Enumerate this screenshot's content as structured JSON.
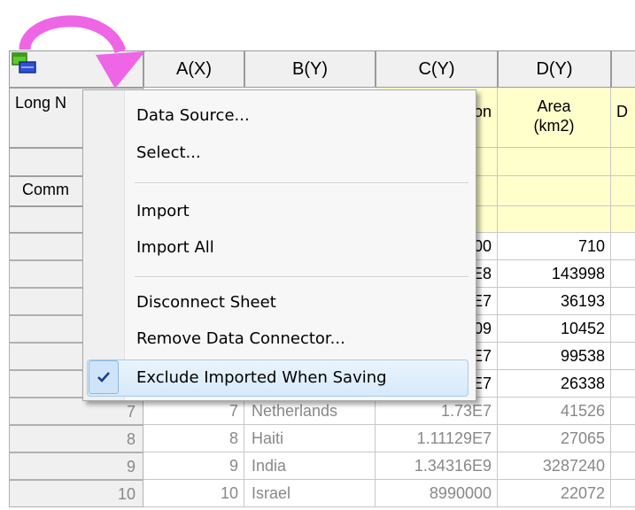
{
  "columns": {
    "a": "A(X)",
    "b": "B(Y)",
    "c": "C(Y)",
    "d": "D(Y)"
  },
  "label_rows": {
    "long_name": "Long N",
    "comments": "Comm",
    "c_long_name_part": "on",
    "area_line1": "Area",
    "area_line2": "(km2)",
    "e_long_name_part": "D"
  },
  "rows": [
    {
      "index": "",
      "c": "00",
      "d": "710"
    },
    {
      "index": "",
      "c": "E8",
      "d": "143998"
    },
    {
      "index": "",
      "c": "E7",
      "d": "36193"
    },
    {
      "index": "",
      "c": "09",
      "d": "10452"
    },
    {
      "index": "",
      "c": "E7",
      "d": "99538"
    },
    {
      "index": "",
      "c": "E7",
      "d": "26338"
    },
    {
      "index": "7",
      "a": "7",
      "b": "Netherlands",
      "c": "1.73E7",
      "d": "41526"
    },
    {
      "index": "8",
      "a": "8",
      "b": "Haiti",
      "c": "1.11129E7",
      "d": "27065"
    },
    {
      "index": "9",
      "a": "9",
      "b": "India",
      "c": "1.34316E9",
      "d": "3287240"
    },
    {
      "index": "10",
      "a": "10",
      "b": "Israel",
      "c": "8990000",
      "d": "22072"
    }
  ],
  "menu": {
    "items": [
      "Data Source...",
      "Select...",
      "Import",
      "Import All",
      "Disconnect Sheet",
      "Remove Data Connector...",
      "Exclude Imported When Saving"
    ],
    "checked_item": "Exclude Imported When Saving"
  },
  "colors": {
    "arrow": "#ee66e6",
    "label_yellow": "#ffffcc",
    "highlight": "#d6e9fa",
    "icon_green": "#5ec92a",
    "icon_blue": "#2e4fd6"
  },
  "icons": {
    "corner": "data-connector-icon",
    "arrow": "curved-arrow-icon",
    "check": "checkmark-icon"
  }
}
